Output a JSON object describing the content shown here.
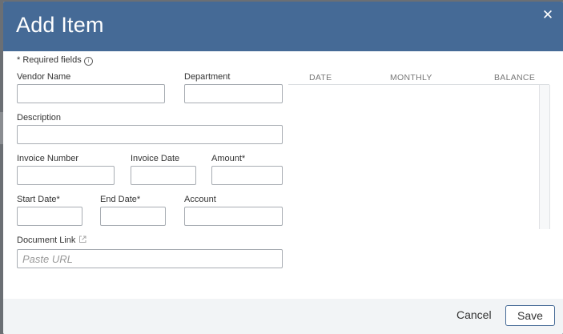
{
  "modal": {
    "title": "Add Item",
    "close_icon": "close-icon",
    "required_note": "* Required fields"
  },
  "form": {
    "vendor_name": {
      "label": "Vendor Name",
      "value": ""
    },
    "department": {
      "label": "Department",
      "value": ""
    },
    "description": {
      "label": "Description",
      "value": ""
    },
    "invoice_number": {
      "label": "Invoice Number",
      "value": ""
    },
    "invoice_date": {
      "label": "Invoice Date",
      "value": ""
    },
    "amount": {
      "label": "Amount*",
      "value": ""
    },
    "start_date": {
      "label": "Start Date*",
      "value": ""
    },
    "end_date": {
      "label": "End Date*",
      "value": ""
    },
    "account": {
      "label": "Account",
      "value": ""
    },
    "document_link": {
      "label": "Document Link",
      "value": "",
      "placeholder": "Paste URL"
    }
  },
  "schedule_grid": {
    "columns": [
      "DATE",
      "MONTHLY",
      "BALANCE"
    ],
    "rows": []
  },
  "footer": {
    "cancel_label": "Cancel",
    "save_label": "Save"
  },
  "colors": {
    "header_bg": "#456a96",
    "footer_bg": "#f2f4f6"
  }
}
